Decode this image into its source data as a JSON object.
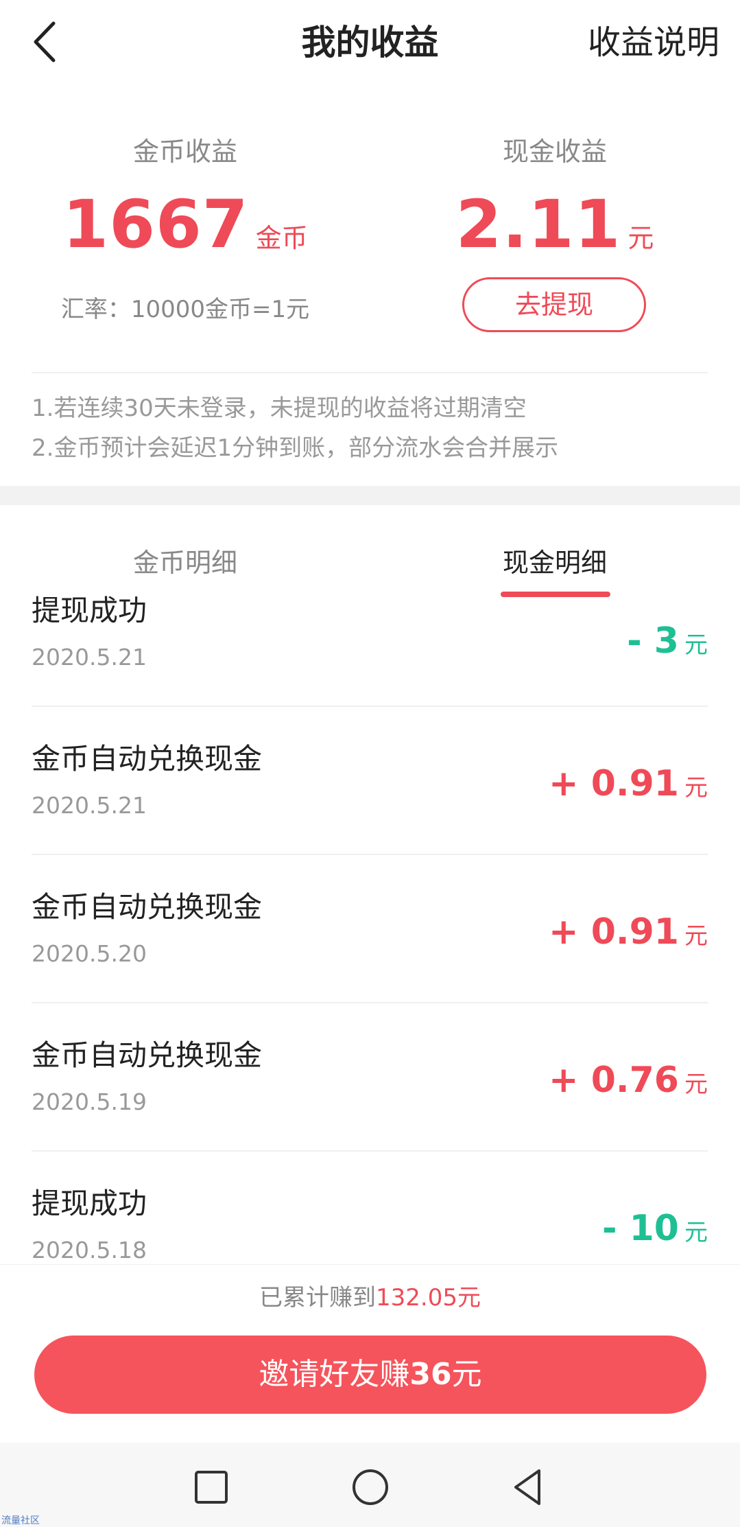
{
  "header": {
    "title": "我的收益",
    "explain_label": "收益说明"
  },
  "summary": {
    "coin": {
      "label": "金币收益",
      "value": "1667",
      "unit": "金币"
    },
    "cash": {
      "label": "现金收益",
      "value": "2.11",
      "unit": "元"
    },
    "rate_text": "汇率：10000金币=1元",
    "withdraw_label": "去提现"
  },
  "notices": [
    "1.若连续30天未登录，未提现的收益将过期清空",
    "2.金币预计会延迟1分钟到账，部分流水会合并展示"
  ],
  "tabs": [
    {
      "label": "金币明细",
      "active": false
    },
    {
      "label": "现金明细",
      "active": true
    }
  ],
  "records": [
    {
      "title": "提现成功",
      "date": "2020.5.21",
      "amount": "- 3",
      "unit": "元",
      "type": "negative"
    },
    {
      "title": "金币自动兑换现金",
      "date": "2020.5.21",
      "amount": "+ 0.91",
      "unit": "元",
      "type": "positive"
    },
    {
      "title": "金币自动兑换现金",
      "date": "2020.5.20",
      "amount": "+ 0.91",
      "unit": "元",
      "type": "positive"
    },
    {
      "title": "金币自动兑换现金",
      "date": "2020.5.19",
      "amount": "+ 0.76",
      "unit": "元",
      "type": "positive"
    },
    {
      "title": "提现成功",
      "date": "2020.5.18",
      "amount": "- 10",
      "unit": "元",
      "type": "negative"
    }
  ],
  "footer": {
    "total_prefix": "已累计赚到",
    "total_amount": "132.05元",
    "invite_prefix": "邀请好友赚",
    "invite_amount": "36",
    "invite_suffix": "元"
  },
  "watermark": "流量社区",
  "colors": {
    "accent": "#ef4a57",
    "negative": "#1fbf94",
    "button": "#f5545c"
  },
  "icons": {
    "back": "chevron-left-icon",
    "nav": [
      "square-icon",
      "circle-icon",
      "triangle-back-icon"
    ]
  }
}
